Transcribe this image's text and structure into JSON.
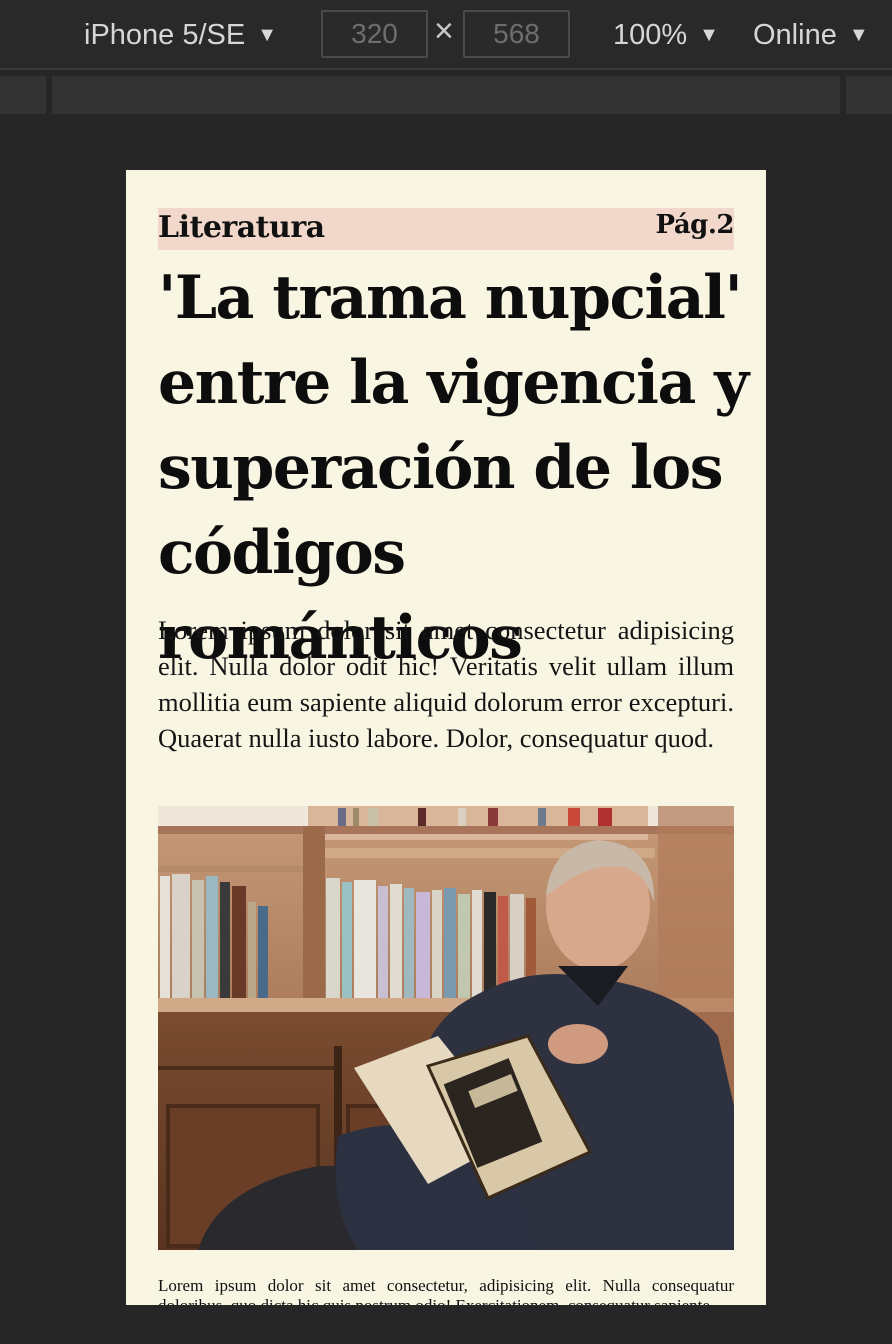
{
  "devtools": {
    "device": "iPhone 5/SE",
    "width": "320",
    "height": "568",
    "zoom": "100%",
    "network": "Online",
    "times_symbol": "×",
    "caret": "▼"
  },
  "article": {
    "section": "Literatura",
    "page": "Pág.2",
    "headline": "'La trama nupcial' entre la vigencia y superación de los códigos románticos",
    "lede": "Lorem ipsum dolor sit amet consectetur adipisicing elit. Nulla dolor odit hic! Veritatis velit ullam illum mollitia eum sapiente aliquid dolorum error excepturi. Quaerat nulla iusto labore. Dolor, consequatur quod.",
    "photo_alt": "man-reading-book",
    "caption": "Lorem ipsum dolor sit amet consectetur, adipisicing elit. Nulla consequatur doloribus, quo dicta hic quis nostrum odio! Exercitationem, consequatur sapiente."
  }
}
